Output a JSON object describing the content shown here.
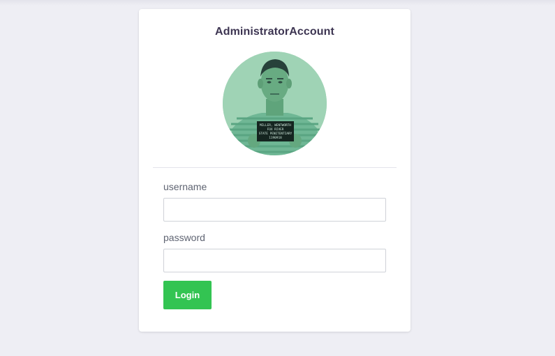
{
  "card": {
    "title": "AdministratorAccount",
    "avatar": {
      "icon": "profile-photo",
      "placard_lines": [
        "MILLER, WENTWORTH",
        "FOX RIVER",
        "STATE PENITENTIARY",
        "1190918"
      ]
    }
  },
  "form": {
    "username_label": "username",
    "username_value": "",
    "password_label": "password",
    "password_value": "",
    "login_label": "Login"
  },
  "colors": {
    "background": "#eeeef4",
    "card": "#ffffff",
    "title": "#3d3552",
    "label": "#5f6472",
    "accent": "#33c452",
    "avatar_tint": "#8ec9a8"
  }
}
